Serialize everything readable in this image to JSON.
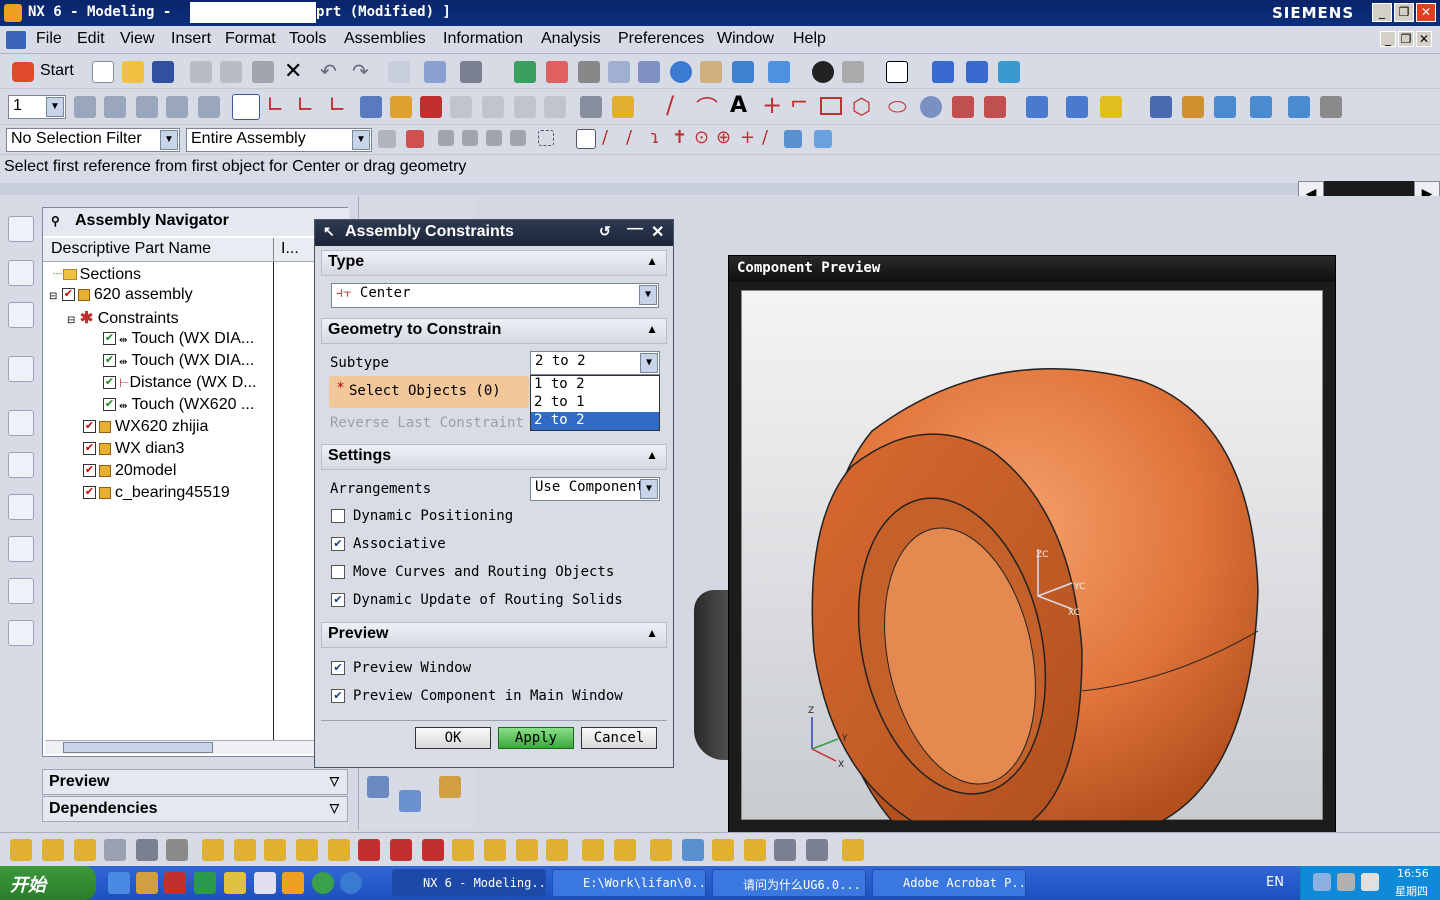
{
  "window": {
    "title_prefix": "NX 6 - Modeling -",
    "title_suffix": "prt (Modified) ]",
    "brand": "SIEMENS"
  },
  "menu": [
    "File",
    "Edit",
    "View",
    "Insert",
    "Format",
    "Tools",
    "Assemblies",
    "Information",
    "Analysis",
    "Preferences",
    "Window",
    "Help"
  ],
  "toolbar": {
    "start_label": "Start",
    "layer_value": "1",
    "selection_filter": "No Selection Filter",
    "scope": "Entire Assembly"
  },
  "status_message": "Select first reference from first object for Center or drag geometry",
  "navigator": {
    "title": "Assembly Navigator",
    "col_name": "Descriptive Part Name",
    "col_info": "I...",
    "rows": [
      {
        "label": "Sections"
      },
      {
        "label": "620 assembly"
      },
      {
        "label": "Constraints"
      },
      {
        "label": "Touch (WX DIA..."
      },
      {
        "label": "Touch (WX DIA..."
      },
      {
        "label": "Distance (WX D..."
      },
      {
        "label": "Touch (WX620 ..."
      },
      {
        "label": "WX620 zhijia"
      },
      {
        "label": "WX dian3"
      },
      {
        "label": "20model"
      },
      {
        "label": "c_bearing45519"
      }
    ],
    "preview_label": "Preview",
    "dependencies_label": "Dependencies"
  },
  "dialog": {
    "title": "Assembly Constraints",
    "type_section": "Type",
    "type_value": "Center",
    "geometry_section": "Geometry to Constrain",
    "subtype_label": "Subtype",
    "subtype_value": "2 to 2",
    "subtype_options": [
      "1 to 2",
      "2 to 1",
      "2 to 2"
    ],
    "select_objects": "Select Objects (0)",
    "reverse_last": "Reverse Last Constraint",
    "settings_section": "Settings",
    "arrangements_label": "Arrangements",
    "arrangements_value": "Use Component",
    "opt_dynamic_positioning": "Dynamic Positioning",
    "opt_associative": "Associative",
    "opt_move_curves": "Move Curves and Routing Objects",
    "opt_dynamic_update": "Dynamic Update of Routing Solids",
    "preview_section": "Preview",
    "opt_preview_window": "Preview Window",
    "opt_preview_component": "Preview Component in Main Window",
    "ok": "OK",
    "apply": "Apply",
    "cancel": "Cancel",
    "checked": {
      "dynamic_positioning": false,
      "associative": true,
      "move_curves": false,
      "dynamic_update": true,
      "preview_window": true,
      "preview_component": true
    }
  },
  "preview": {
    "title": "Component Preview",
    "axis_z": "Z",
    "axis_y": "Y",
    "axis_x": "X",
    "wcs_z": "ZC",
    "wcs_y": "YC",
    "wcs_x": "XC",
    "color": "#e0743a"
  },
  "taskbar": {
    "start": "开始",
    "tasks": [
      "NX 6 - Modeling...",
      "E:\\Work\\lifan\\0...",
      "请问为什么UG6.0...",
      "Adobe Acrobat P..."
    ],
    "lang": "EN",
    "time": "16:56",
    "day": "星期四"
  }
}
